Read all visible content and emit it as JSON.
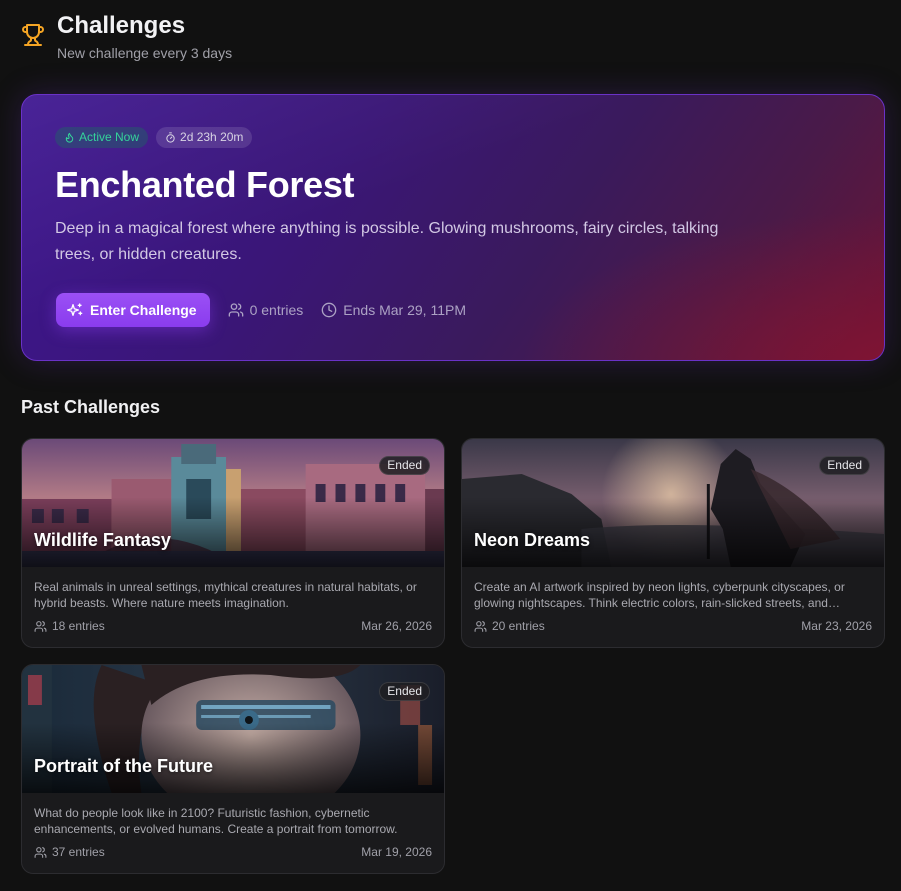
{
  "header": {
    "title": "Challenges",
    "subtitle": "New challenge every 3 days",
    "icon": "trophy-icon",
    "icon_color": "#f5a524"
  },
  "active": {
    "status": "Active Now",
    "time_left": "2d 23h 20m",
    "title": "Enchanted Forest",
    "description": "Deep in a magical forest where anything is possible. Glowing mushrooms, fairy circles, talking trees, or hidden creatures.",
    "button_label": "Enter Challenge",
    "entries": "0 entries",
    "ends": "Ends Mar 29, 11PM",
    "accent": "#8b3df0"
  },
  "past": {
    "title": "Past Challenges",
    "cards": [
      {
        "badge": "Ended",
        "title": "Wildlife Fantasy",
        "description": "Real animals in unreal settings, mythical creatures in natural habitats, or hybrid beasts. Where nature meets imagination.",
        "entries": "18 entries",
        "date": "Mar 26, 2026"
      },
      {
        "badge": "Ended",
        "title": "Neon Dreams",
        "description": "Create an AI artwork inspired by neon lights, cyberpunk cityscapes, or glowing nightscapes. Think electric colors, rain-slicked streets, and futuristic vibes.",
        "entries": "20 entries",
        "date": "Mar 23, 2026"
      },
      {
        "badge": "Ended",
        "title": "Portrait of the Future",
        "description": "What do people look like in 2100? Futuristic fashion, cybernetic enhancements, or evolved humans. Create a portrait from tomorrow.",
        "entries": "37 entries",
        "date": "Mar 19, 2026"
      }
    ]
  }
}
